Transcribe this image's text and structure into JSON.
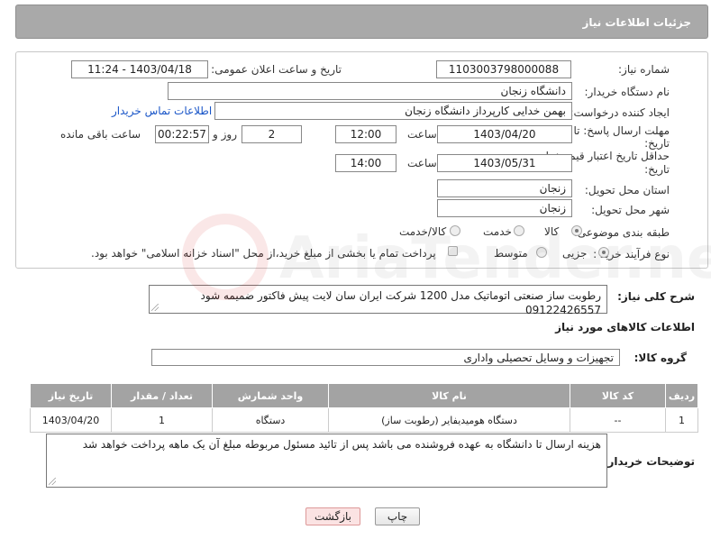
{
  "header": {
    "title": "جزئیات اطلاعات نیاز"
  },
  "labels": {
    "need_number": "شماره نیاز:",
    "announce_datetime": "تاریخ و ساعت اعلان عمومی:",
    "buyer_org": "نام دستگاه خریدار:",
    "requester": "ایجاد کننده درخواست:",
    "contact_link": "اطلاعات تماس خریدار",
    "reply_deadline_line1": "مهلت ارسال پاسخ: تا",
    "reply_deadline_line2": "تاریخ:",
    "time": "ساعت",
    "day_and": "روز و",
    "time_remaining": "ساعت باقی مانده",
    "price_validity_line1": "حداقل تاریخ اعتبار قیمت: تا",
    "price_validity_line2": "تاریخ:",
    "time2": "ساعت",
    "province": "استان محل تحویل:",
    "city": "شهر محل تحویل:",
    "category": "طبقه بندی موضوعی:",
    "category_goods": "کالا",
    "category_service": "خدمت",
    "category_goods_service": "کالا/خدمت",
    "process_type": "نوع فرآیند خرید :",
    "process_minor": "جزیی",
    "process_medium": "متوسط",
    "payment_note": "پرداخت تمام یا بخشی از مبلغ خرید،از محل \"اسناد خزانه اسلامی\" خواهد بود.",
    "general_description": "شرح کلی نیاز:",
    "goods_info_title": "اطلاعات کالاهای مورد نیاز",
    "goods_group": "گروه کالا:",
    "buyer_notes": "توضیحات خریدار:"
  },
  "values": {
    "need_number": "1103003798000088",
    "announce_datetime": "1403/04/18 - 11:24",
    "buyer_org": "دانشگاه زنجان",
    "requester": "بهمن خدایی کارپرداز دانشگاه زنجان",
    "reply_date": "1403/04/20",
    "reply_time": "12:00",
    "remaining_days": "2",
    "remaining_time": "00:22:57",
    "price_validity_date": "1403/05/31",
    "price_validity_time": "14:00",
    "province": "زنجان",
    "city": "زنجان",
    "general_description": "رطوبت ساز صنعتی اتوماتیک مدل 1200 شرکت ایران سان لایت پیش فاکتور ضمیمه شود 09122426557",
    "goods_group": "تجهیزات و وسایل تحصیلی واداری",
    "buyer_notes": "هزینه ارسال تا دانشگاه به عهده فروشنده می باشد پس از تائید مسئول مربوطه مبلغ آن یک ماهه پرداخت خواهد شد"
  },
  "table": {
    "headers": {
      "row": "ردیف",
      "code": "کد کالا",
      "name": "نام کالا",
      "unit": "واحد شمارش",
      "qty": "تعداد / مقدار",
      "date": "تاریخ نیاز"
    },
    "rows": [
      {
        "row": "1",
        "code": "--",
        "name": "دستگاه هومیدیفایر (رطوبت ساز)",
        "unit": "دستگاه",
        "qty": "1",
        "date": "1403/04/20"
      }
    ]
  },
  "buttons": {
    "print": "چاپ",
    "back": "بازگشت"
  },
  "watermark": {
    "text": "AriaTender.net"
  }
}
